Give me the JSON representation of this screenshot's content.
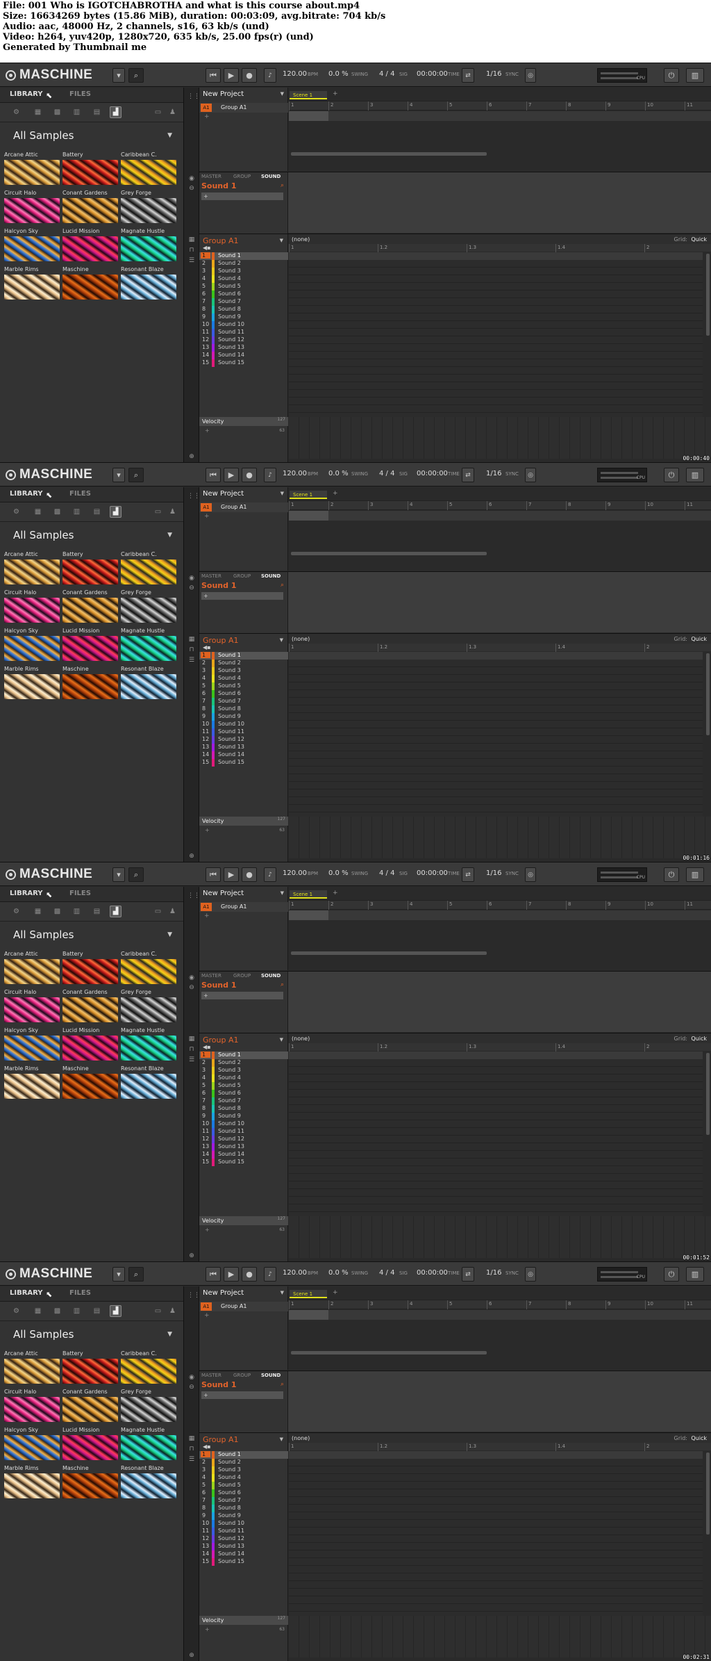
{
  "header": {
    "file": "File: 001 Who is IGOTCHABROTHA and what is this course about.mp4",
    "size": "Size: 16634269 bytes (15.86 MiB), duration: 00:03:09, avg.bitrate: 704 kb/s",
    "audio": "Audio: aac, 48000 Hz, 2 channels, s16, 63 kb/s (und)",
    "video": "Video: h264, yuv420p, 1280x720, 635 kb/s, 25.00 fps(r) (und)",
    "generated": "Generated by Thumbnail me"
  },
  "app": {
    "logo": "MASCHINE",
    "bpm": "120.00",
    "bpm_unit": "BPM",
    "swing": "0.0 %",
    "swing_label": "SWING",
    "sig": "4 / 4",
    "sig_label": "SIG",
    "time": "00:00:00",
    "time_label": "TIME",
    "quant": "1/16",
    "sync": "SYNC",
    "cpu": "CPU"
  },
  "browser": {
    "tab_library": "LIBRARY",
    "tab_files": "FILES",
    "selected": "All Samples",
    "tiles": [
      {
        "label": "Arcane Attic",
        "colors": [
          "#2a1b10",
          "#d89a3a",
          "#f4d68a",
          "#3b2412"
        ]
      },
      {
        "label": "Battery",
        "colors": [
          "#2a0606",
          "#c21a1a",
          "#ff6a3a",
          "#1a0404"
        ]
      },
      {
        "label": "Caribbean C.",
        "colors": [
          "#1a1a10",
          "#f2d11a",
          "#f0a020",
          "#333"
        ]
      },
      {
        "label": "Circuit Halo",
        "colors": [
          "#200a20",
          "#e0207a",
          "#ff7ab8",
          "#120412"
        ]
      },
      {
        "label": "Conant Gardens",
        "colors": [
          "#241608",
          "#d8902a",
          "#f2c16a",
          "#140a04"
        ]
      },
      {
        "label": "Grey Forge",
        "colors": [
          "#0a0a0a",
          "#6a6a6a",
          "#d8d8d8",
          "#1a1a1a"
        ]
      },
      {
        "label": "Halcyon Sky",
        "colors": [
          "#0a2a5a",
          "#3a7ad8",
          "#f2b24a",
          "#4a2a0a"
        ]
      },
      {
        "label": "Lucid Mission",
        "colors": [
          "#2a0420",
          "#d21a8a",
          "#ff3a5a",
          "#180412"
        ]
      },
      {
        "label": "Magnate Hustle",
        "colors": [
          "#062a1a",
          "#1ad28a",
          "#3ae0e0",
          "#0a1a2a"
        ]
      },
      {
        "label": "Marble Rims",
        "colors": [
          "#3a2a1a",
          "#e8c08a",
          "#fff0d0",
          "#2a1a0a"
        ]
      },
      {
        "label": "Maschine",
        "colors": [
          "#2a0a02",
          "#b2400a",
          "#e8701a",
          "#1a0602"
        ]
      },
      {
        "label": "Resonant Blaze",
        "colors": [
          "#0a1a2a",
          "#6ab0d8",
          "#e0f0ff",
          "#1a2a3a"
        ]
      }
    ]
  },
  "arranger": {
    "project": "New Project",
    "group_badge": "A1",
    "group_name": "Group A1",
    "scene": "Scene 1",
    "bars": [
      "1",
      "2",
      "3",
      "4",
      "5",
      "6",
      "7",
      "8",
      "9",
      "10",
      "11"
    ]
  },
  "control": {
    "tab_master": "MASTER",
    "tab_group": "GROUP",
    "tab_sound": "SOUND",
    "sound_name": "Sound 1"
  },
  "pattern": {
    "group": "Group A1",
    "pattern_name": "(none)",
    "grid_label": "Grid:",
    "grid_value": "Quick",
    "ruler": [
      "1",
      "1.2",
      "1.3",
      "1.4",
      "2"
    ],
    "sounds": [
      {
        "n": "1",
        "name": "Sound 1",
        "color": "#e0621f"
      },
      {
        "n": "2",
        "name": "Sound 2",
        "color": "#e8a51a"
      },
      {
        "n": "3",
        "name": "Sound 3",
        "color": "#e8c81a"
      },
      {
        "n": "4",
        "name": "Sound 4",
        "color": "#e8e01a"
      },
      {
        "n": "5",
        "name": "Sound 5",
        "color": "#9ad21a"
      },
      {
        "n": "6",
        "name": "Sound 6",
        "color": "#3ac21a"
      },
      {
        "n": "7",
        "name": "Sound 7",
        "color": "#1ac27a"
      },
      {
        "n": "8",
        "name": "Sound 8",
        "color": "#1ac2b2"
      },
      {
        "n": "9",
        "name": "Sound 9",
        "color": "#1aa2e0"
      },
      {
        "n": "10",
        "name": "Sound 10",
        "color": "#1a7ae0"
      },
      {
        "n": "11",
        "name": "Sound 11",
        "color": "#3a5ae0"
      },
      {
        "n": "12",
        "name": "Sound 12",
        "color": "#6a3ae0"
      },
      {
        "n": "13",
        "name": "Sound 13",
        "color": "#a21ae0"
      },
      {
        "n": "14",
        "name": "Sound 14",
        "color": "#d21ab2"
      },
      {
        "n": "15",
        "name": "Sound 15",
        "color": "#e01a7a"
      }
    ],
    "velocity": "Velocity",
    "vel_max": "127",
    "vel_min": "63"
  },
  "timestamps": [
    "00:00:40",
    "00:01:16",
    "00:01:52",
    "00:02:31"
  ]
}
